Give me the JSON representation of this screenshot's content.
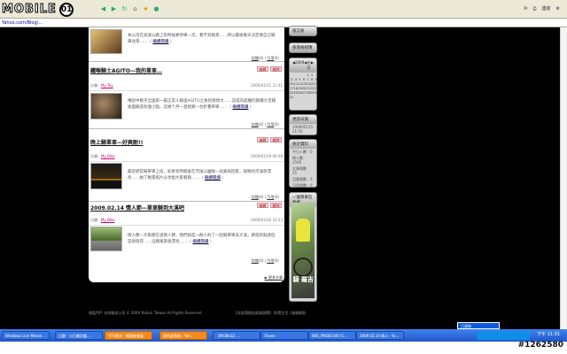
{
  "browser": {
    "logo_text": "MOBILE",
    "logo_bubble": "01",
    "address": "Yahoo.com/Blog/...",
    "tray_label": "連結"
  },
  "posts": [
    {
      "id": "post-0",
      "title": "",
      "excerpt": "本公司在高速公路上有時候要停車一次，看不到風景……所以最後幾天決定要自己騎車往南……（ ",
      "read_more": "繼續閱讀",
      "excerpt_end": " ）",
      "link_label": "討論",
      "link_count": "(0)",
      "ref_label": "引用",
      "ref_count": "(0)"
    },
    {
      "id": "post-1",
      "title": "鐵喉騎士AGITO—我的單車…",
      "edit": "編輯",
      "del": "刪除",
      "category_label": "分類：",
      "category": "My Toy",
      "date": "2009/02/21 21:41",
      "excerpt": "傳說中幾乎全国第一篇正常人騎過AGITO之後的感想文……這成為超魔的鋼鐵大音箱後面騎道有個小點。這幾个月一直想買一台折疊單車……（ ",
      "read_more": "繼續閱讀",
      "excerpt_end": " ）",
      "link_label": "討論",
      "link_count": "(0)",
      "ref_label": "引用",
      "ref_count": "(0)"
    },
    {
      "id": "post-2",
      "title": "晚上騎單車—好爽耐!!",
      "edit": "編輯",
      "del": "刪除",
      "category_label": "分類：",
      "category": "My Bike",
      "date": "2009/02/19 09:38",
      "excerpt": "最近經常騎單車上班，如果有時間會在河濱公園繞一段路再回家，夜晚的河濱很漂亮……拍了幾張照片分享給大家看看……（ ",
      "read_more": "繼續閱讀",
      "excerpt_end": " ）",
      "link_label": "討論",
      "link_count": "(0)",
      "ref_label": "引用",
      "ref_count": "(0)"
    },
    {
      "id": "post-3",
      "title": "2009.02.14 情人節—單車騎到大溪吧",
      "edit": "編輯",
      "del": "刪除",
      "category_label": "分類：",
      "category": "My Bike",
      "date": "2009/02/16 10:33",
      "excerpt": "情人節—大家都在過情人節，我們則是一群人約了一起騎單車去大溪，路程有點遠但是很值得……沿路風景很漂亮……（ ",
      "read_more": "繼續閱讀",
      "excerpt_end": " ）",
      "link_label": "討論",
      "link_count": "(0)",
      "ref_label": "引用",
      "ref_count": "(0)"
    }
  ],
  "more_posts": "▶ 更多文章",
  "sidebar": {
    "box1": "留言板",
    "box2": "部落格相簿",
    "calendar": {
      "year": "2009",
      "month": "五月",
      "days": [
        [
          "",
          "",
          "",
          "",
          "1",
          "2",
          ""
        ],
        [
          "3",
          "4",
          "5",
          "6",
          "7",
          "8",
          "9"
        ],
        [
          "10",
          "11",
          "12",
          "13",
          "14",
          "15",
          "16"
        ],
        [
          "17",
          "18",
          "19",
          "20",
          "21",
          "22",
          "23"
        ],
        [
          "24",
          "25",
          "26",
          "27",
          "28",
          "29",
          "30"
        ],
        [
          "31",
          "",
          "",
          "",
          "",
          "",
          ""
        ]
      ]
    },
    "updated_title": "更新日期",
    "updated_value": "2009/05/15 21:03",
    "stats_title": "統計資料",
    "stats": [
      "今日人數：0",
      "總人數：1560",
      "文章總數：25",
      "回應總數：0",
      "引用總數：0"
    ],
    "photo_title": "一個單車狂熱者",
    "photo_caption": "騎 羅吉"
  },
  "footer": {
    "left": "高監門戶  台灣雅虎公司 © 2009 Yahoo! Taiwan All Rights Reserved",
    "right": "【本部落格由高屑版費】  財貴生活  |  服務條款"
  },
  "taskbar": {
    "tasks": [
      {
        "label": "Windows Live Messe...",
        "color": "blue"
      },
      {
        "label": "日劇 - 小日劇討論...",
        "color": "blue"
      },
      {
        "label": "YTG图文 - 網路無會員",
        "color": "orange"
      },
      {
        "label": "我的部落格 - Yah...",
        "color": "orange"
      },
      {
        "label": "【MOBILE】...",
        "color": "blue"
      },
      {
        "label": "iTunes",
        "color": "blue"
      },
      {
        "label": "BBS_PRIDE/340 (C...",
        "color": "blue"
      },
      {
        "label": "2009.02.14 情人 - Ya...",
        "color": "blue"
      }
    ],
    "clock": "下午 11:31",
    "notice": "已連線"
  },
  "watermark": "#1262580"
}
